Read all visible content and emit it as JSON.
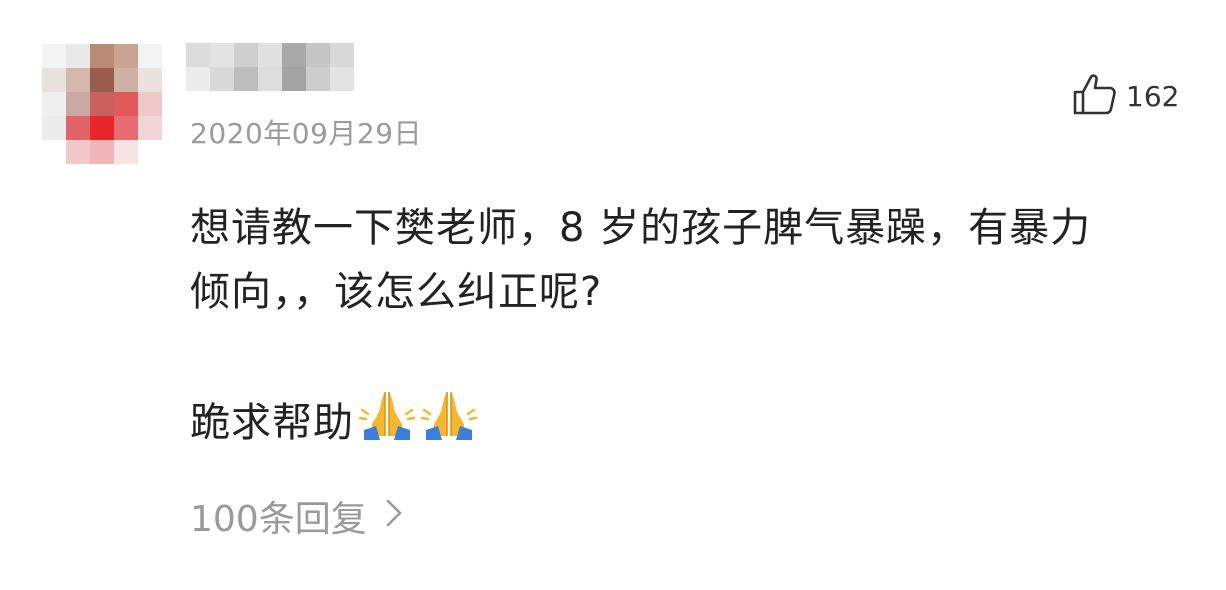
{
  "comment": {
    "date": "2020年09月29日",
    "likes": "162",
    "line1": "想请教一下樊老师，8 岁的孩子脾气暴躁，有暴力",
    "line2": "倾向，，该怎么纠正呢?",
    "line3": "跪求帮助",
    "emojis": [
      "folded-hands-emoji",
      "folded-hands-emoji"
    ],
    "replies": "100条回复"
  },
  "icons": {
    "like": "thumbs-up-icon",
    "chevron": "chevron-right-icon"
  },
  "colors": {
    "meta": "#9b9b9b",
    "text": "#222222",
    "avatar_accent": "#e8262b"
  }
}
